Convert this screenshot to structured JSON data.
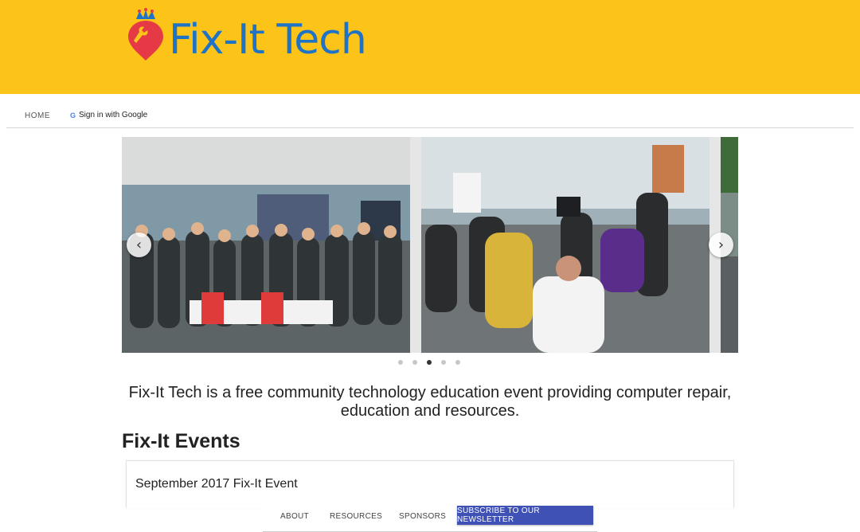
{
  "header": {
    "brand": "Fix-It Tech",
    "colors": {
      "background": "#fcc419",
      "brand_text": "#1f73c6",
      "logo_red": "#e63946",
      "logo_blue": "#1f73c6"
    }
  },
  "nav": {
    "home": "HOME",
    "signin": "Sign in with Google",
    "signin_icon": "G"
  },
  "carousel": {
    "prev_icon": "‹",
    "next_icon": "›",
    "slide_count": 5,
    "active_index": 2
  },
  "tagline": "Fix-It Tech is a free community technology education event providing computer repair, education and resources.",
  "events": {
    "heading": "Fix-It Events",
    "items": [
      {
        "title": "September 2017 Fix-It Event"
      }
    ]
  },
  "footer_nav": {
    "about": "ABOUT",
    "resources": "RESOURCES",
    "sponsors": "SPONSORS",
    "subscribe": "SUBSCRIBE TO OUR NEWSLETTER",
    "subscribe_color": "#3f51b5"
  }
}
